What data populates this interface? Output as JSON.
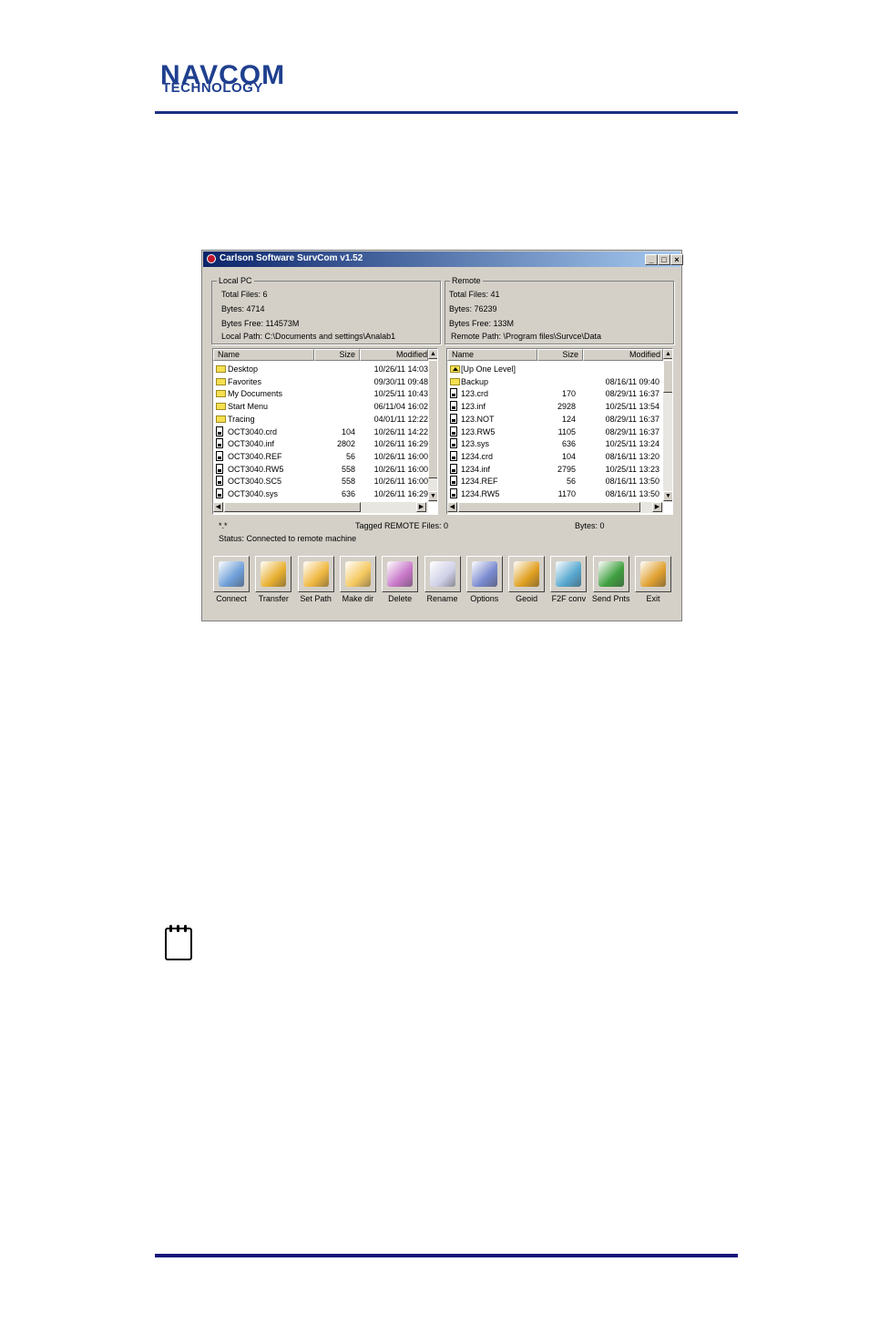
{
  "logo": {
    "line1": "NAVCOM",
    "line2": "TECHNOLOGY"
  },
  "window": {
    "title": "Carlson Software SurvCom v1.52",
    "controls": [
      "_",
      "□",
      "×"
    ]
  },
  "local": {
    "group_label": "Local PC",
    "total_files": "Total Files: 6",
    "bytes": "Bytes: 4714",
    "bytes_free": "Bytes Free: 114573M",
    "path": "Local Path: C:\\Documents and settings\\Analab1",
    "columns": [
      "Name",
      "Size",
      "Modified"
    ],
    "rows": [
      {
        "type": "folder",
        "name": "Desktop",
        "size": "",
        "modified": "10/26/11 14:03"
      },
      {
        "type": "folder",
        "name": "Favorites",
        "size": "",
        "modified": "09/30/11 09:48"
      },
      {
        "type": "folder",
        "name": "My Documents",
        "size": "",
        "modified": "10/25/11 10:43"
      },
      {
        "type": "folder",
        "name": "Start Menu",
        "size": "",
        "modified": "06/11/04 16:02"
      },
      {
        "type": "folder",
        "name": "Tracing",
        "size": "",
        "modified": "04/01/11 12:22"
      },
      {
        "type": "file",
        "name": "OCT3040.crd",
        "size": "104",
        "modified": "10/26/11 14:22"
      },
      {
        "type": "file",
        "name": "OCT3040.inf",
        "size": "2802",
        "modified": "10/26/11 16:29"
      },
      {
        "type": "file",
        "name": "OCT3040.REF",
        "size": "56",
        "modified": "10/26/11 16:00"
      },
      {
        "type": "file",
        "name": "OCT3040.RW5",
        "size": "558",
        "modified": "10/26/11 16:00"
      },
      {
        "type": "file",
        "name": "OCT3040.SC5",
        "size": "558",
        "modified": "10/26/11 16:00"
      },
      {
        "type": "file",
        "name": "OCT3040.sys",
        "size": "636",
        "modified": "10/26/11 16:29"
      }
    ]
  },
  "remote": {
    "group_label": "Remote",
    "total_files": "Total Files: 41",
    "bytes": "Bytes: 76239",
    "bytes_free": "Bytes Free: 133M",
    "path": "Remote Path: \\Program files\\Survce\\Data",
    "columns": [
      "Name",
      "Size",
      "Modified"
    ],
    "rows": [
      {
        "type": "up",
        "name": "[Up One Level]",
        "size": "",
        "modified": ""
      },
      {
        "type": "folder",
        "name": "Backup",
        "size": "",
        "modified": "08/16/11 09:40"
      },
      {
        "type": "file",
        "name": "123.crd",
        "size": "170",
        "modified": "08/29/11 16:37"
      },
      {
        "type": "file",
        "name": "123.inf",
        "size": "2928",
        "modified": "10/25/11 13:54"
      },
      {
        "type": "file",
        "name": "123.NOT",
        "size": "124",
        "modified": "08/29/11 16:37"
      },
      {
        "type": "file",
        "name": "123.RW5",
        "size": "1105",
        "modified": "08/29/11 16:37"
      },
      {
        "type": "file",
        "name": "123.sys",
        "size": "636",
        "modified": "10/25/11 13:24"
      },
      {
        "type": "file",
        "name": "1234.crd",
        "size": "104",
        "modified": "08/16/11 13:20"
      },
      {
        "type": "file",
        "name": "1234.inf",
        "size": "2795",
        "modified": "10/25/11 13:23"
      },
      {
        "type": "file",
        "name": "1234.REF",
        "size": "56",
        "modified": "08/16/11 13:50"
      },
      {
        "type": "file",
        "name": "1234.RW5",
        "size": "1170",
        "modified": "08/16/11 13:50"
      }
    ]
  },
  "status": {
    "filter": "*.*",
    "tagged": "Tagged REMOTE Files: 0",
    "bytes": "Bytes: 0",
    "message": "Status: Connected to remote machine"
  },
  "toolbar": [
    {
      "label": "Connect",
      "icon": "connect-icon",
      "color": "#6f9fd8"
    },
    {
      "label": "Transfer",
      "icon": "transfer-icon",
      "color": "#e8b030"
    },
    {
      "label": "Set Path",
      "icon": "set-path-icon",
      "color": "#f0b840"
    },
    {
      "label": "Make dir",
      "icon": "make-dir-icon",
      "color": "#f5c860"
    },
    {
      "label": "Delete",
      "icon": "delete-icon",
      "color": "#c878c8"
    },
    {
      "label": "Rename",
      "icon": "rename-icon",
      "color": "#d0d0e8"
    },
    {
      "label": "Options",
      "icon": "options-icon",
      "color": "#7a8ad0"
    },
    {
      "label": "Geoid",
      "icon": "geoid-icon",
      "color": "#e0a020"
    },
    {
      "label": "F2F conv",
      "icon": "f2f-conv-icon",
      "color": "#58a8d0"
    },
    {
      "label": "Send Pnts",
      "icon": "send-points-icon",
      "color": "#40a040"
    },
    {
      "label": "Exit",
      "icon": "exit-icon",
      "color": "#e0a030"
    }
  ]
}
